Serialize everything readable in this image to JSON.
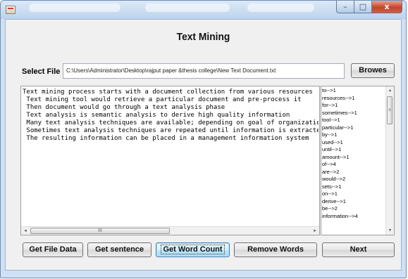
{
  "window": {
    "controls": {
      "minimize": "–",
      "maximize": "□",
      "close": "x"
    }
  },
  "heading": "Text Mining",
  "select_file": {
    "label": "Select File",
    "path": "C:\\Users\\Administrator\\Desktop\\rajput paper &thesis college\\New Text Document.txt",
    "browse_button": "Browes"
  },
  "document_lines": [
    "Text mining process starts with a document collection from various resources",
    " Text mining tool would retrieve a particular document and pre-process it",
    " Then document would go through a text analysis phase",
    " Text analysis is semantic analysis to derive high quality information",
    " Many text analysis techniques are available; depending on goal of organization",
    " Sometimes text analysis techniques are repeated until information is extracted",
    " The resulting information can be placed in a management information system"
  ],
  "word_counts": [
    "to-->1",
    "resources-->1",
    "for-->1",
    "sometimes-->1",
    "tool-->1",
    "particular-->1",
    "by-->1",
    "used-->1",
    "until-->1",
    "amount-->1",
    "of-->4",
    "are-->2",
    "would-->2",
    "sets-->1",
    "on-->1",
    "derive-->1",
    "be-->2",
    "information-->4"
  ],
  "scrollbar_glyphs": {
    "left": "◂",
    "right": "▸",
    "up": "▴",
    "down": "▾",
    "h_grip": "III",
    "v_grip": "≡"
  },
  "buttons": {
    "get_file_data": "Get File Data",
    "get_sentence": "Get sentence",
    "get_word_count": "Get Word Count",
    "remove_words": "Remove Words",
    "next": "Next"
  }
}
